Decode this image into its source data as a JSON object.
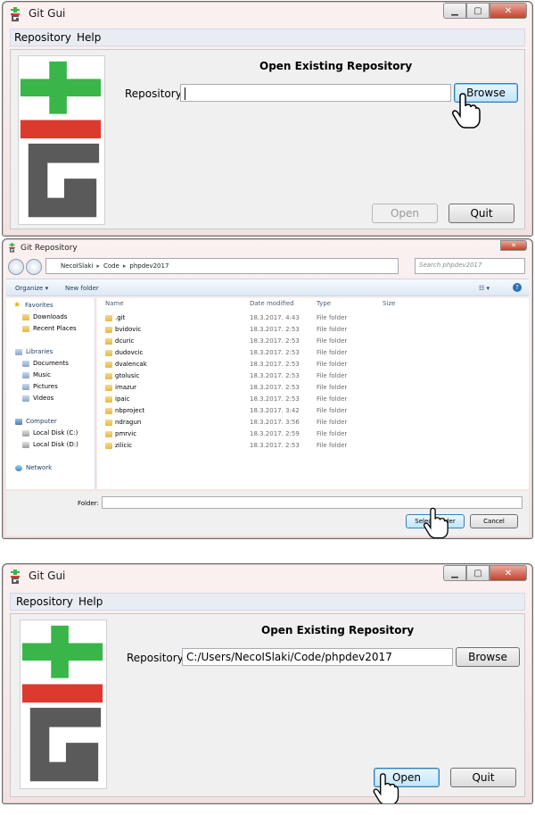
{
  "colors": {
    "git_green": "#39b54a",
    "git_red": "#dc3a2f",
    "git_gray": "#5a5a5a"
  },
  "window1": {
    "title": "Git Gui",
    "menu": [
      "Repository",
      "Help"
    ],
    "heading": "Open Existing Repository",
    "repo_label": "Repository:",
    "repo_value": "",
    "browse_label": "Browse",
    "open_label": "Open",
    "quit_label": "Quit"
  },
  "dialog": {
    "title": "Git Repository",
    "breadcrumb": [
      "NecoISlaki",
      "Code",
      "phpdev2017"
    ],
    "search_placeholder": "Search phpdev2017",
    "toolbar": {
      "organize": "Organize ▾",
      "new_folder": "New folder"
    },
    "nav": {
      "favorites": "Favorites",
      "downloads": "Downloads",
      "recent": "Recent Places",
      "libraries": "Libraries",
      "documents": "Documents",
      "music": "Music",
      "pictures": "Pictures",
      "videos": "Videos",
      "computer": "Computer",
      "disk_c": "Local Disk (C:)",
      "disk_d": "Local Disk (D:)",
      "network": "Network"
    },
    "columns": {
      "name": "Name",
      "date": "Date modified",
      "type": "Type",
      "size": "Size"
    },
    "files": [
      {
        "name": ".git",
        "date": "18.3.2017. 4:43",
        "type": "File folder"
      },
      {
        "name": "bvidovic",
        "date": "18.3.2017. 2:53",
        "type": "File folder"
      },
      {
        "name": "dcuric",
        "date": "18.3.2017. 2:53",
        "type": "File folder"
      },
      {
        "name": "dudovcic",
        "date": "18.3.2017. 2:53",
        "type": "File folder"
      },
      {
        "name": "dvalencak",
        "date": "18.3.2017. 2:53",
        "type": "File folder"
      },
      {
        "name": "gtolusic",
        "date": "18.3.2017. 2:53",
        "type": "File folder"
      },
      {
        "name": "imazur",
        "date": "18.3.2017. 2:53",
        "type": "File folder"
      },
      {
        "name": "ipaic",
        "date": "18.3.2017. 2:53",
        "type": "File folder"
      },
      {
        "name": "nbproject",
        "date": "18.3.2017. 3:42",
        "type": "File folder"
      },
      {
        "name": "ndragun",
        "date": "18.3.2017. 3:56",
        "type": "File folder"
      },
      {
        "name": "pmrvic",
        "date": "18.3.2017. 2:59",
        "type": "File folder"
      },
      {
        "name": "zilicic",
        "date": "18.3.2017. 2:53",
        "type": "File folder"
      }
    ],
    "folder_label": "Folder:",
    "select_label": "Select Folder",
    "cancel_label": "Cancel"
  },
  "window2": {
    "title": "Git Gui",
    "menu": [
      "Repository",
      "Help"
    ],
    "heading": "Open Existing Repository",
    "repo_label": "Repository:",
    "repo_value": "C:/Users/NecoISlaki/Code/phpdev2017",
    "browse_label": "Browse",
    "open_label": "Open",
    "quit_label": "Quit"
  }
}
